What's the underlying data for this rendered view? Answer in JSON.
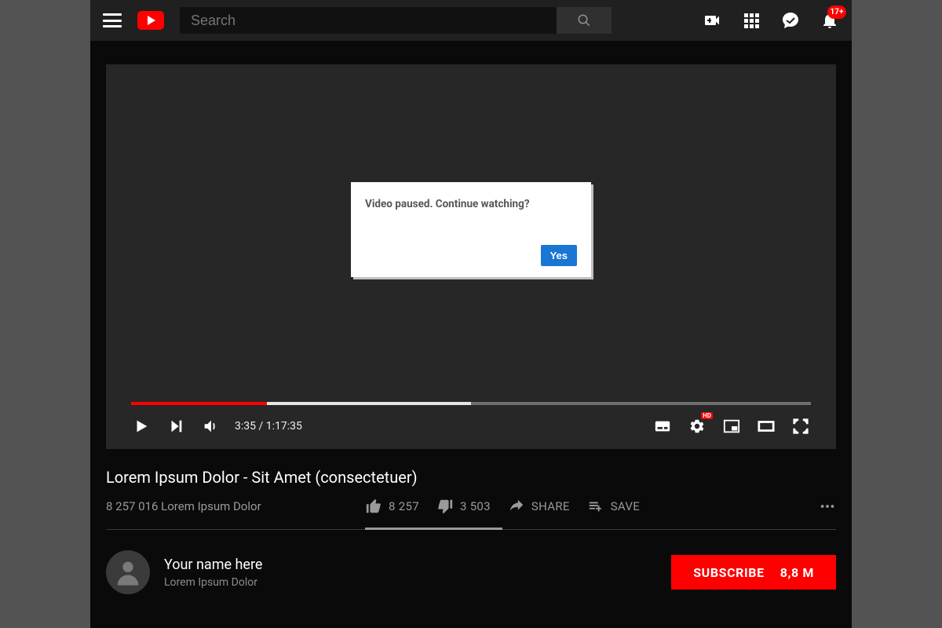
{
  "topbar": {
    "search_placeholder": "Search",
    "notification_count": "17+"
  },
  "modal": {
    "text": "Video paused. Continue watching?",
    "yes_label": "Yes"
  },
  "player": {
    "played_percent": 20,
    "buffer_percent": 50,
    "current_time": "3:35",
    "duration": "1:17:35",
    "time_display": "3:35 / 1:17:35",
    "hd_badge": "HD"
  },
  "video": {
    "title": "Lorem Ipsum Dolor - Sit Amet (consectetuer)",
    "views_line": "8 257 016 Lorem Ipsum Dolor",
    "likes": "8 257",
    "dislikes": "3 503",
    "share_label": "SHARE",
    "save_label": "SAVE"
  },
  "channel": {
    "name": "Your name here",
    "desc": "Lorem Ipsum Dolor",
    "subscribe_label": "SUBSCRIBE",
    "sub_count": "8,8 M"
  }
}
